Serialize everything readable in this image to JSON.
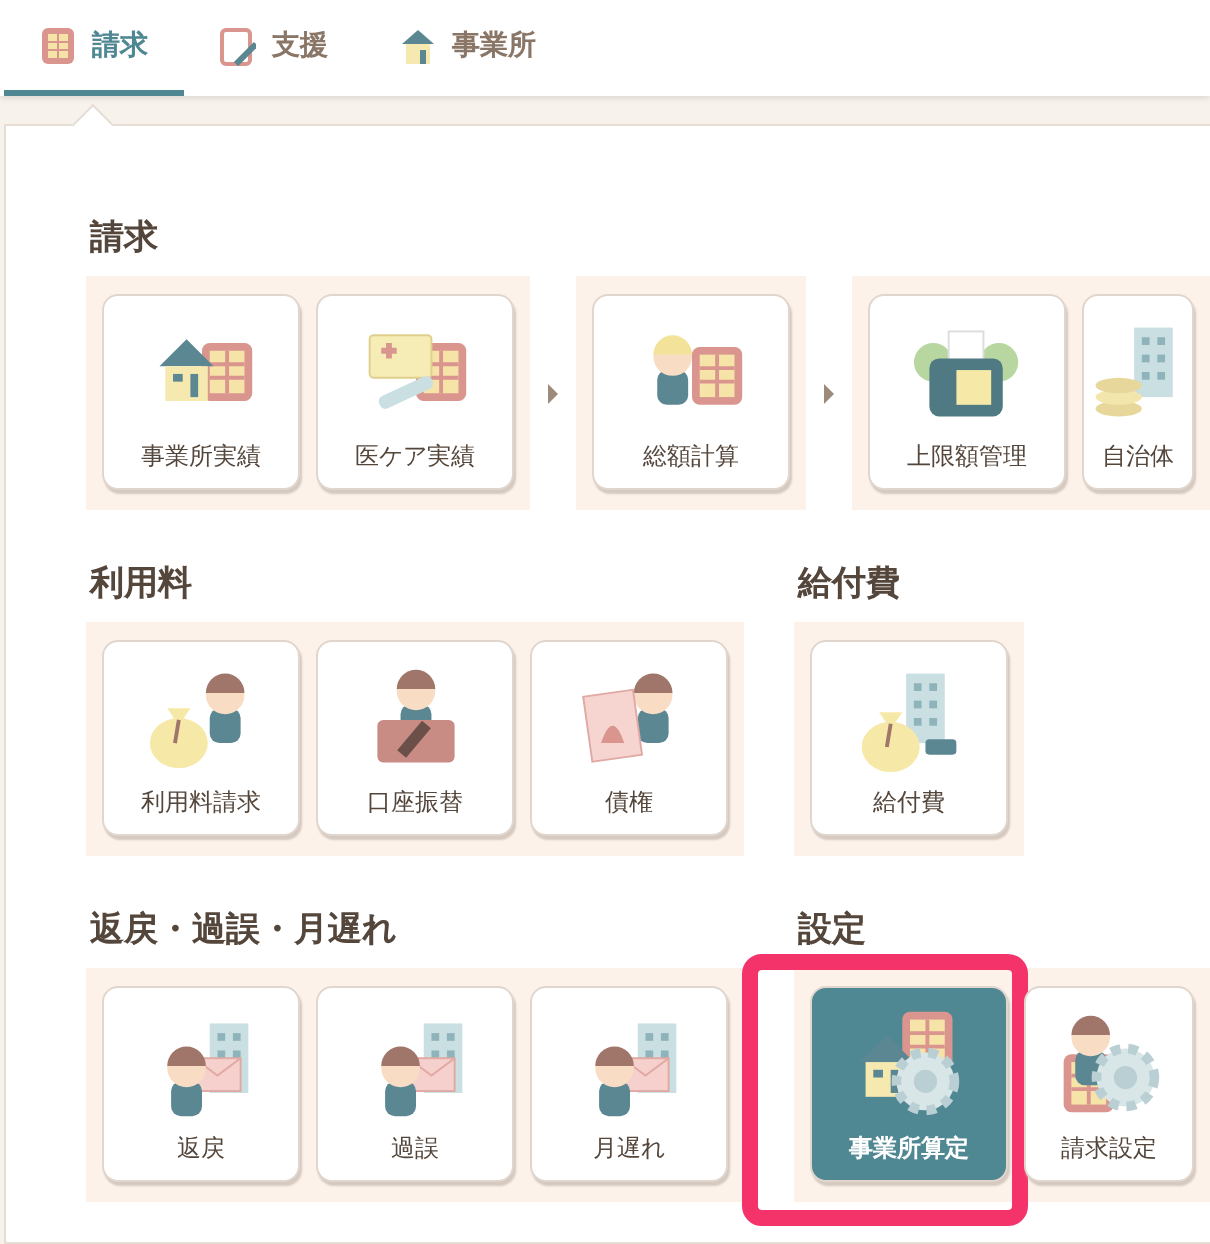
{
  "tabs": [
    {
      "label": "請求",
      "kind": "calculator",
      "selected": true
    },
    {
      "label": "支援",
      "kind": "clipboard",
      "selected": false
    },
    {
      "label": "事業所",
      "kind": "house",
      "selected": false
    }
  ],
  "rows": [
    {
      "sections": [
        {
          "title": "請求",
          "groups": [
            {
              "items": [
                {
                  "label": "事業所実績",
                  "kind": "house-calc",
                  "selected": false,
                  "highlighted": false
                },
                {
                  "label": "医ケア実績",
                  "kind": "card-calc",
                  "selected": false,
                  "highlighted": false
                }
              ]
            },
            {
              "items": [
                {
                  "label": "総額計算",
                  "kind": "person-calc",
                  "selected": false,
                  "highlighted": false
                }
              ]
            },
            {
              "items": [
                {
                  "label": "上限額管理",
                  "kind": "fax",
                  "selected": false,
                  "highlighted": false
                },
                {
                  "label": "自治体",
                  "kind": "coins",
                  "selected": false,
                  "highlighted": false
                }
              ]
            }
          ]
        }
      ]
    },
    {
      "sections": [
        {
          "title": "利用料",
          "groups": [
            {
              "items": [
                {
                  "label": "利用料請求",
                  "kind": "bag-person",
                  "selected": false,
                  "highlighted": false
                },
                {
                  "label": "口座振替",
                  "kind": "box-person",
                  "selected": false,
                  "highlighted": false
                },
                {
                  "label": "債権",
                  "kind": "doc-person",
                  "selected": false,
                  "highlighted": false
                }
              ]
            }
          ]
        },
        {
          "title": "給付費",
          "groups": [
            {
              "items": [
                {
                  "label": "給付費",
                  "kind": "bag-building",
                  "selected": false,
                  "highlighted": false
                }
              ]
            }
          ]
        }
      ]
    },
    {
      "sections": [
        {
          "title": "返戻・過誤・月遅れ",
          "groups": [
            {
              "items": [
                {
                  "label": "返戻",
                  "kind": "envelope-person",
                  "selected": false,
                  "highlighted": false
                },
                {
                  "label": "過誤",
                  "kind": "envelope-person",
                  "selected": false,
                  "highlighted": false
                },
                {
                  "label": "月遅れ",
                  "kind": "envelope-person",
                  "selected": false,
                  "highlighted": false
                }
              ]
            }
          ]
        },
        {
          "title": "設定",
          "groups": [
            {
              "items": [
                {
                  "label": "事業所算定",
                  "kind": "house-gear",
                  "selected": true,
                  "highlighted": true
                },
                {
                  "label": "請求設定",
                  "kind": "person-gear",
                  "selected": false,
                  "highlighted": false
                }
              ]
            }
          ]
        }
      ]
    }
  ]
}
